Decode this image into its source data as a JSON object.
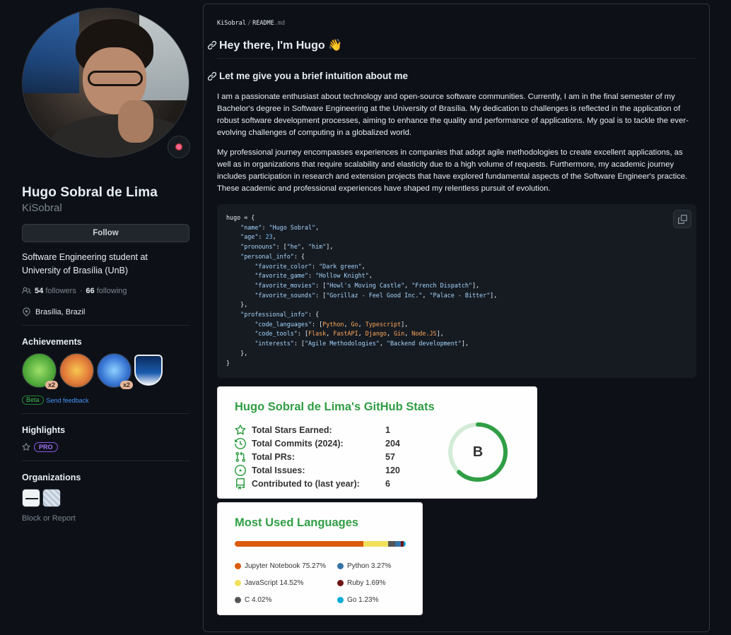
{
  "profile": {
    "full_name": "Hugo Sobral de Lima",
    "login": "KiSobral",
    "follow_label": "Follow",
    "bio_line1": "Software Engineering student at",
    "bio_line2": "University of Brasília (UnB)",
    "followers_count": "54",
    "followers_label": "followers",
    "separator": "·",
    "following_count": "66",
    "following_label": "following",
    "location": "Brasília, Brazil",
    "status_icon": "dart-icon"
  },
  "sidebar": {
    "achievements_title": "Achievements",
    "achievements": [
      {
        "icon": "pair-extraordinaire-icon",
        "count": "x2"
      },
      {
        "icon": "yolo-icon",
        "count": ""
      },
      {
        "icon": "pull-shark-icon",
        "count": "x2"
      },
      {
        "icon": "arctic-code-vault-icon",
        "count": ""
      }
    ],
    "beta_label": "Beta",
    "feedback_label": "Send feedback",
    "highlights_title": "Highlights",
    "pro_label": "PRO",
    "organizations_title": "Organizations",
    "block_label": "Block or Report"
  },
  "readme": {
    "breadcrumb_owner": "KiSobral",
    "breadcrumb_sep": "/",
    "breadcrumb_file": "README",
    "breadcrumb_ext": ".md",
    "h1": "Hey there, I'm Hugo 👋",
    "h2": "Let me give you a brief intuition about me",
    "p1": "I am a passionate enthusiast about technology and open-source software communities. Currently, I am in the final semester of my Bachelor's degree in Software Engineering at the University of Brasília. My dedication to challenges is reflected in the application of robust software development processes, aiming to enhance the quality and performance of applications. My goal is to tackle the ever-evolving challenges of computing in a globalized world.",
    "p2": "My professional journey encompasses experiences in companies that adopt agile methodologies to create excellent applications, as well as in organizations that require scalability and elasticity due to a high volume of requests. Furthermore, my academic journey includes participation in research and extension projects that have explored fundamental aspects of the Software Engineer's practice. These academic and professional experiences have shaped my relentless pursuit of evolution."
  },
  "code": {
    "var": "hugo",
    "name_key": "\"name\"",
    "name_val": "\"Hugo Sobral\"",
    "age_key": "\"age\"",
    "age_val": "23",
    "pronouns_key": "\"pronouns\"",
    "pronoun1": "\"he\"",
    "pronoun2": "\"him\"",
    "personal_key": "\"personal_info\"",
    "color_key": "\"favorite_color\"",
    "color_val": "\"Dark green\"",
    "game_key": "\"favorite_game\"",
    "game_val": "\"Hollow Knight\"",
    "movies_key": "\"favorite_movies\"",
    "movie1": "\"Howl's Moving Castle\"",
    "movie2": "\"French Dispatch\"",
    "sounds_key": "\"favorite_sounds\"",
    "sound1": "\"Gorillaz - Feel Good Inc.\"",
    "sound2": "\"Palace - Bitter\"",
    "professional_key": "\"professional_info\"",
    "langs_key": "\"code_languages\"",
    "lang1": "Python",
    "lang2": "Go",
    "lang3": "Typescript",
    "tools_key": "\"code_tools\"",
    "tool1": "Flask",
    "tool2": "FastAPI",
    "tool3": "Django",
    "tool4": "Gin",
    "tool5": "Node.JS",
    "interests_key": "\"interests\"",
    "interest1": "\"Agile Methodologies\"",
    "interest2": "\"Backend development\""
  },
  "stats": {
    "title": "Hugo Sobral de Lima's GitHub Stats",
    "rows": [
      {
        "label": "Total Stars Earned:",
        "value": "1",
        "icon": "star-icon"
      },
      {
        "label": "Total Commits (2024):",
        "value": "204",
        "icon": "history-icon"
      },
      {
        "label": "Total PRs:",
        "value": "57",
        "icon": "pull-request-icon"
      },
      {
        "label": "Total Issues:",
        "value": "120",
        "icon": "issue-icon"
      },
      {
        "label": "Contributed to (last year):",
        "value": "6",
        "icon": "repo-icon"
      }
    ],
    "rank": "B",
    "rank_progress": 0.62,
    "accent": "#2f9e44"
  },
  "languages": {
    "title": "Most Used Languages",
    "items": [
      {
        "label": "Jupyter Notebook 75.27%",
        "percent": 75.27,
        "color": "#da5b0b"
      },
      {
        "label": "Python 3.27%",
        "percent": 3.27,
        "color": "#3572a5"
      },
      {
        "label": "JavaScript 14.52%",
        "percent": 14.52,
        "color": "#f1e05a"
      },
      {
        "label": "Ruby 1.69%",
        "percent": 1.69,
        "color": "#701516"
      },
      {
        "label": "C 4.02%",
        "percent": 4.02,
        "color": "#555555"
      },
      {
        "label": "Go 1.23%",
        "percent": 1.23,
        "color": "#00add8"
      }
    ]
  }
}
